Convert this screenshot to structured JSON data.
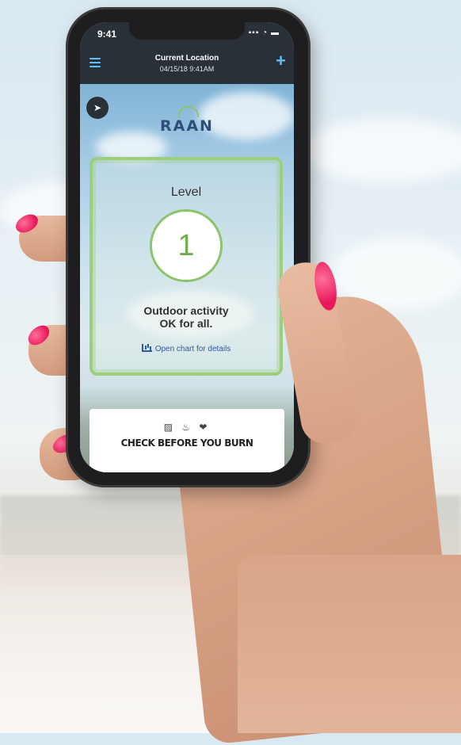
{
  "status_bar": {
    "time": "9:41",
    "signal": "▪▪▪ ◔ ▬"
  },
  "header": {
    "title": "Current Location",
    "subtitle": "04/15/18 9:41AM"
  },
  "logo": "RAAN",
  "level_card": {
    "label": "Level",
    "value": "1",
    "message_line1": "Outdoor activity",
    "message_line2": "OK for all.",
    "link_text": "Open chart for details"
  },
  "burn_card": {
    "icons": "▨ ♨ ❤",
    "title": "CHECK BEFORE YOU BURN"
  },
  "colors": {
    "accent": "#5cc0ff",
    "level_green": "#8cc36b",
    "nail": "#e8185a",
    "navbar": "#2a3038"
  }
}
